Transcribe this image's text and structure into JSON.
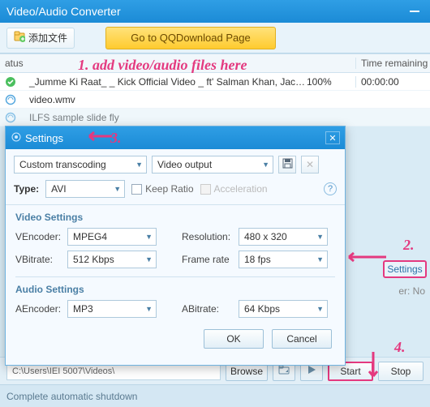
{
  "window": {
    "title": "Video/Audio Converter"
  },
  "toolbar": {
    "add_file": "添加文件",
    "goto": "Go to QQDownload Page"
  },
  "table": {
    "h_status": "atus",
    "h_name": "",
    "h_progress": "",
    "h_time": "Time remaining",
    "rows": [
      {
        "status": "done",
        "name": "_Jumme Ki Raat_ _ Kick Official Video _ ft' Salman Khan, Jacq…",
        "progress": "100%",
        "time": "00:00:00"
      },
      {
        "status": "pending",
        "name": "video.wmv",
        "progress": "",
        "time": ""
      },
      {
        "status": "pending",
        "name": "ILFS sample slide fly",
        "progress": "",
        "time": ""
      }
    ]
  },
  "rightside": {
    "settings_btn": "Settings",
    "er": "er: No"
  },
  "bottom": {
    "path": "C:\\Users\\IEI 5007\\Videos\\",
    "browse": "Browse",
    "start": "Start",
    "stop": "Stop"
  },
  "footer": {
    "text": "Complete automatic shutdown"
  },
  "dialog": {
    "title": "Settings",
    "preset": "Custom transcoding",
    "output": "Video output",
    "type_label": "Type:",
    "type_value": "AVI",
    "keep_ratio": "Keep Ratio",
    "accel": "Acceleration",
    "video_section": "Video Settings",
    "venc_label": "VEncoder:",
    "venc": "MPEG4",
    "res_label": "Resolution:",
    "res": "480 x 320",
    "vbit_label": "VBitrate:",
    "vbit": "512 Kbps",
    "fr_label": "Frame rate",
    "fr": "18 fps",
    "audio_section": "Audio Settings",
    "aenc_label": "AEncoder:",
    "aenc": "MP3",
    "abit_label": "ABitrate:",
    "abit": "64 Kbps",
    "ok": "OK",
    "cancel": "Cancel"
  },
  "anno": {
    "a1": "1.  add video/audio files here",
    "a2": "2.",
    "a3": "3.",
    "a4": "4."
  }
}
